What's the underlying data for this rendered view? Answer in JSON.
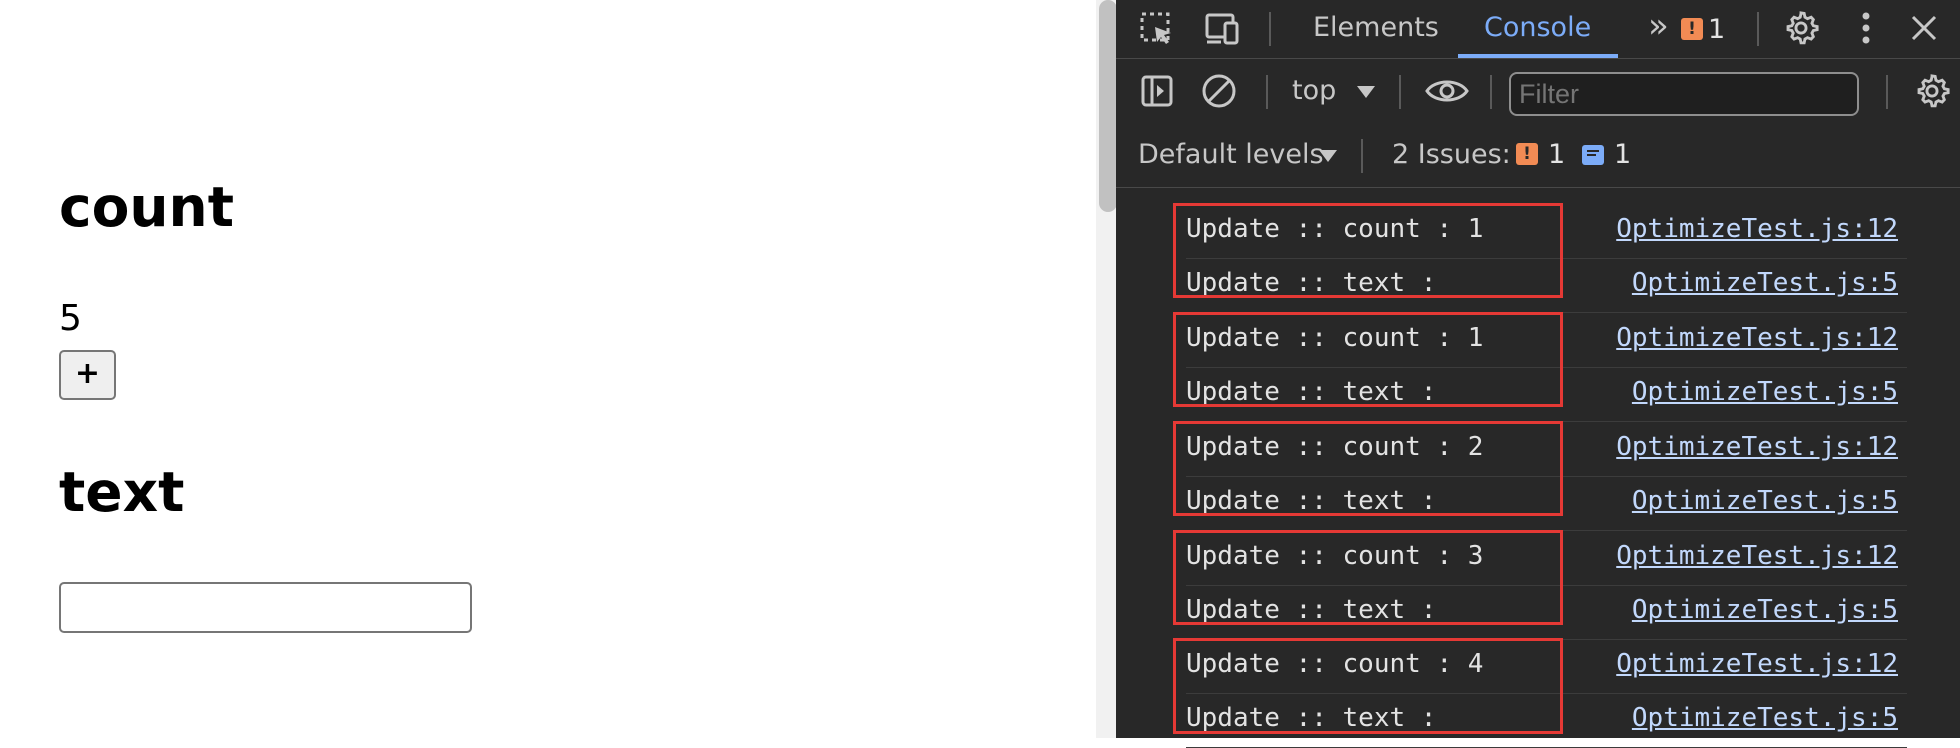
{
  "page": {
    "count_heading": "count",
    "count_value": "5",
    "plus_label": "+",
    "text_heading": "text",
    "text_input_value": ""
  },
  "devtools": {
    "tabs": {
      "elements": "Elements",
      "console": "Console",
      "more": "»"
    },
    "issues_badge_count": "1",
    "toolbar": {
      "context": "top",
      "filter_placeholder": "Filter"
    },
    "levels": {
      "default_levels": "Default levels",
      "issues_label": "2 Issues:",
      "warn_count": "1",
      "info_count": "1"
    },
    "console_rows": [
      {
        "message": "Update :: count : 1",
        "source": "OptimizeTest.js:12"
      },
      {
        "message": "Update :: text :",
        "source": "OptimizeTest.js:5"
      },
      {
        "message": "Update :: count : 1",
        "source": "OptimizeTest.js:12"
      },
      {
        "message": "Update :: text :",
        "source": "OptimizeTest.js:5"
      },
      {
        "message": "Update :: count : 2",
        "source": "OptimizeTest.js:12"
      },
      {
        "message": "Update :: text :",
        "source": "OptimizeTest.js:5"
      },
      {
        "message": "Update :: count : 3",
        "source": "OptimizeTest.js:12"
      },
      {
        "message": "Update :: text :",
        "source": "OptimizeTest.js:5"
      },
      {
        "message": "Update :: count : 4",
        "source": "OptimizeTest.js:12"
      },
      {
        "message": "Update :: text :",
        "source": "OptimizeTest.js:5"
      }
    ],
    "colors": {
      "accent": "#7cacf8",
      "warning": "#f28b54",
      "highlight": "#e53935"
    }
  }
}
